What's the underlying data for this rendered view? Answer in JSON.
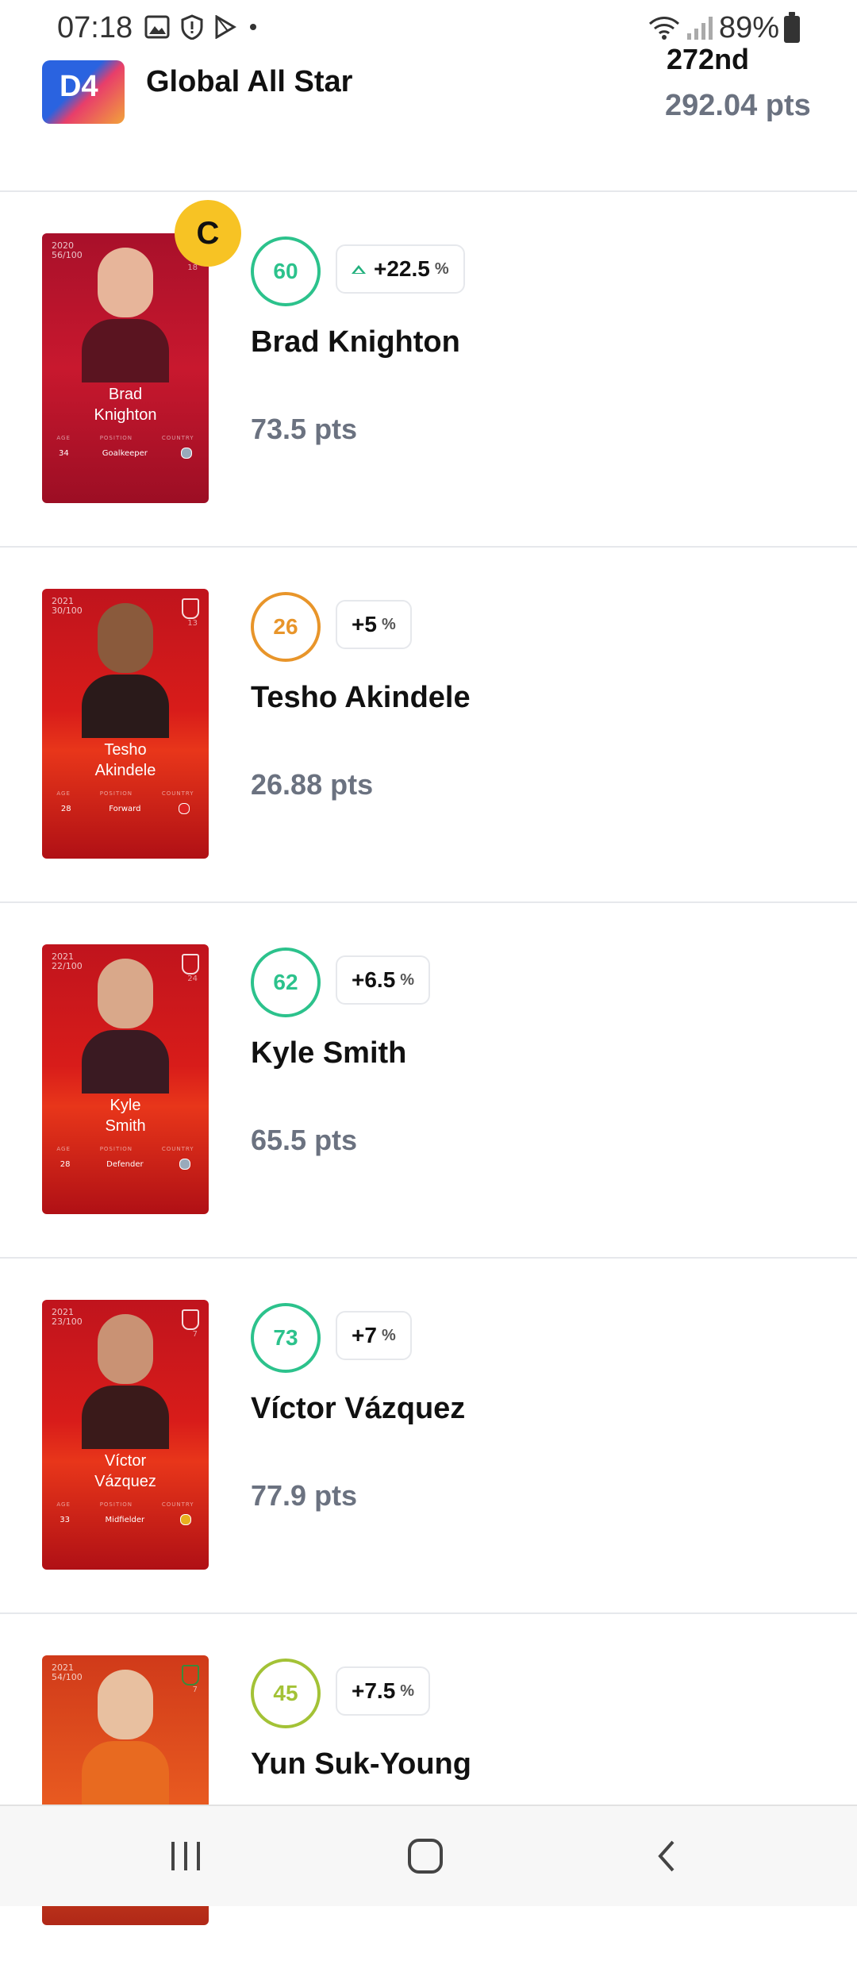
{
  "status_bar": {
    "time": "07:18",
    "battery": "89%",
    "left_icons": [
      "image-icon",
      "alert-shield-icon",
      "play-store-icon",
      "dot-icon"
    ],
    "right_icons": [
      "wifi-icon",
      "signal-icon",
      "battery-icon"
    ]
  },
  "header": {
    "logo_text": "D4",
    "league_name": "Global All Star",
    "rank": "272nd",
    "total_points": "292.04 pts"
  },
  "players": [
    {
      "card_year": "2020",
      "card_serial": "56/100",
      "card_number": "18",
      "card_name": "Brad\nKnighton",
      "age": "34",
      "position": "Goalkeeper",
      "score": "60",
      "score_color": "#2cc28c",
      "bonus": "+22.5",
      "bonus_trend": "up",
      "name": "Brad Knighton",
      "points": "73.5 pts",
      "captain": "C"
    },
    {
      "card_year": "2021",
      "card_serial": "30/100",
      "card_number": "13",
      "card_name": "Tesho\nAkindele",
      "age": "28",
      "position": "Forward",
      "score": "26",
      "score_color": "#e8952a",
      "bonus": "+5",
      "name": "Tesho Akindele",
      "points": "26.88 pts"
    },
    {
      "card_year": "2021",
      "card_serial": "22/100",
      "card_number": "24",
      "card_name": "Kyle\nSmith",
      "age": "28",
      "position": "Defender",
      "score": "62",
      "score_color": "#2cc28c",
      "bonus": "+6.5",
      "name": "Kyle Smith",
      "points": "65.5 pts"
    },
    {
      "card_year": "2021",
      "card_serial": "23/100",
      "card_number": "7",
      "card_name": "Víctor\nVázquez",
      "age": "33",
      "position": "Midfielder",
      "score": "73",
      "score_color": "#2cc28c",
      "bonus": "+7",
      "name": "Víctor Vázquez",
      "points": "77.9 pts"
    },
    {
      "card_year": "2021",
      "card_serial": "54/100",
      "card_number": "7",
      "card_name": "",
      "age": "",
      "position": "",
      "score": "45",
      "score_color": "#a3c236",
      "bonus": "+7.5",
      "name": "Yun Suk-Young",
      "points": ""
    }
  ],
  "card_labels": {
    "age": "AGE",
    "position": "POSITION",
    "country": "COUNTRY"
  },
  "bonus_suffix": "%",
  "navbar": {
    "buttons": [
      "recent-apps-icon",
      "home-icon",
      "back-icon"
    ]
  }
}
